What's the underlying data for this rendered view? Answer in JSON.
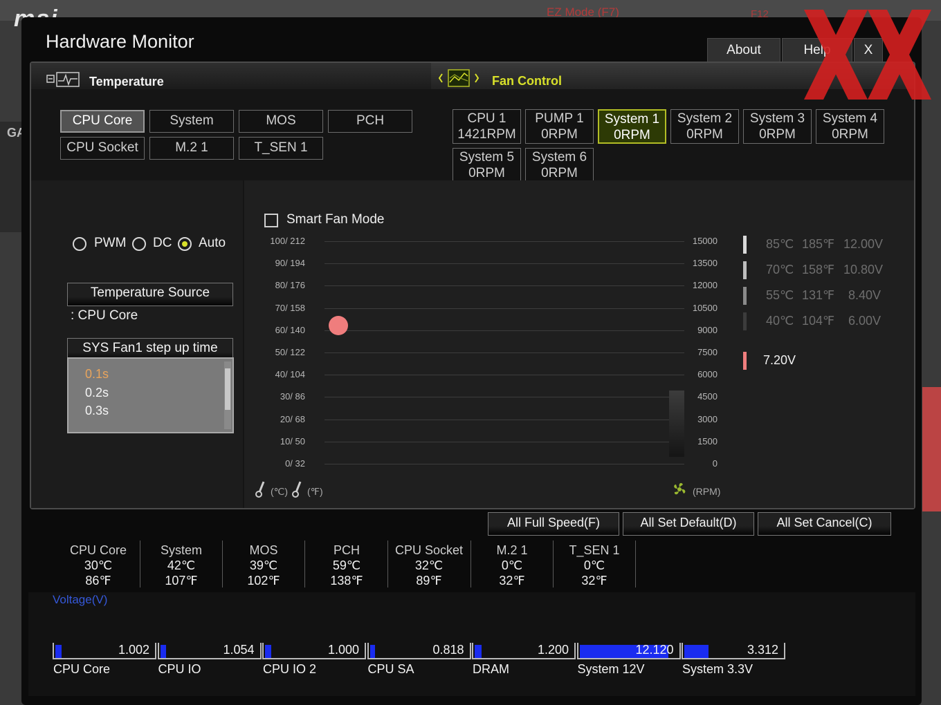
{
  "background": {
    "brand": "msi",
    "ez_mode": "EZ Mode (F7)",
    "f12": "F12"
  },
  "window": {
    "title": "Hardware Monitor",
    "about": "About",
    "help": "Help",
    "close": "X"
  },
  "tabs": {
    "temperature": "Temperature",
    "fan_control": "Fan Control"
  },
  "temp_sources": [
    {
      "label": "CPU Core",
      "active": true
    },
    {
      "label": "System",
      "active": false
    },
    {
      "label": "MOS",
      "active": false
    },
    {
      "label": "PCH",
      "active": false
    },
    {
      "label": "CPU Socket",
      "active": false
    },
    {
      "label": "M.2 1",
      "active": false
    },
    {
      "label": "T_SEN 1",
      "active": false
    }
  ],
  "fans": [
    {
      "name": "CPU 1",
      "rpm": "1421RPM",
      "active": false
    },
    {
      "name": "PUMP 1",
      "rpm": "0RPM",
      "active": false
    },
    {
      "name": "System 1",
      "rpm": "0RPM",
      "active": true
    },
    {
      "name": "System 2",
      "rpm": "0RPM",
      "active": false
    },
    {
      "name": "System 3",
      "rpm": "0RPM",
      "active": false
    },
    {
      "name": "System 4",
      "rpm": "0RPM",
      "active": false
    },
    {
      "name": "System 5",
      "rpm": "0RPM",
      "active": false
    },
    {
      "name": "System 6",
      "rpm": "0RPM",
      "active": false
    }
  ],
  "mode": {
    "pwm": "PWM",
    "dc": "DC",
    "auto": "Auto",
    "selected": "Auto"
  },
  "temperature_source": {
    "button": "Temperature Source",
    "value": ": CPU Core"
  },
  "step_up": {
    "button": "SYS Fan1 step up time",
    "options": [
      "0.1s",
      "0.2s",
      "0.3s"
    ],
    "selected": "0.1s"
  },
  "smart_fan": {
    "label": "Smart Fan Mode",
    "checked": false
  },
  "chart": {
    "left_ticks": [
      "100/ 212",
      "90/ 194",
      "80/ 176",
      "70/ 158",
      "60/ 140",
      "50/ 122",
      "40/ 104",
      "30/  86",
      "20/  68",
      "10/  50",
      "0/  32"
    ],
    "right_ticks": [
      "15000",
      "13500",
      "12000",
      "10500",
      "9000",
      "7500",
      "6000",
      "4500",
      "3000",
      "1500",
      "0"
    ],
    "unit_c": "(℃)",
    "unit_f": "(℉)",
    "unit_rpm": "(RPM)"
  },
  "chart_data": {
    "type": "scatter",
    "x_label": "(℃)",
    "y_label": "(RPM)",
    "points": [
      {
        "temp_c": 62,
        "rpm": 0
      }
    ]
  },
  "levels": [
    {
      "c": "85℃",
      "f": "185℉",
      "v": "12.00V",
      "color": "#d9d9d9"
    },
    {
      "c": "70℃",
      "f": "158℉",
      "v": "10.80V",
      "color": "#bdbdbd"
    },
    {
      "c": "55℃",
      "f": "131℉",
      "v": "8.40V",
      "color": "#8a8a8a"
    },
    {
      "c": "40℃",
      "f": "104℉",
      "v": "6.00V",
      "color": "#3c3c3c"
    }
  ],
  "current_voltage": {
    "value": "7.20V",
    "color": "#ef7d7d"
  },
  "actions": {
    "full_speed": "All Full Speed(F)",
    "set_default": "All Set Default(D)",
    "set_cancel": "All Set Cancel(C)"
  },
  "temperatures": [
    {
      "name": "CPU Core",
      "c": "30℃",
      "f": "86℉"
    },
    {
      "name": "System",
      "c": "42℃",
      "f": "107℉"
    },
    {
      "name": "MOS",
      "c": "39℃",
      "f": "102℉"
    },
    {
      "name": "PCH",
      "c": "59℃",
      "f": "138℉"
    },
    {
      "name": "CPU Socket",
      "c": "32℃",
      "f": "89℉"
    },
    {
      "name": "M.2 1",
      "c": "0℃",
      "f": "32℉"
    },
    {
      "name": "T_SEN 1",
      "c": "0℃",
      "f": "32℉"
    }
  ],
  "voltage": {
    "title": "Voltage(V)",
    "items": [
      {
        "name": "CPU Core",
        "value": "1.002",
        "fill": 0.06
      },
      {
        "name": "CPU IO",
        "value": "1.054",
        "fill": 0.06
      },
      {
        "name": "CPU IO 2",
        "value": "1.000",
        "fill": 0.06
      },
      {
        "name": "CPU SA",
        "value": "0.818",
        "fill": 0.05
      },
      {
        "name": "DRAM",
        "value": "1.200",
        "fill": 0.07
      },
      {
        "name": "System 12V",
        "value": "12.120",
        "fill": 0.88
      },
      {
        "name": "System 3.3V",
        "value": "3.312",
        "fill": 0.24
      }
    ]
  },
  "colors": {
    "accent": "#d8e02a",
    "fan_active_bg": "#2d3a05",
    "point": "#ef7d7d",
    "voltage_bar": "#1a2cf0",
    "voltage_title": "#3558d9",
    "watermark": "#d42020"
  }
}
